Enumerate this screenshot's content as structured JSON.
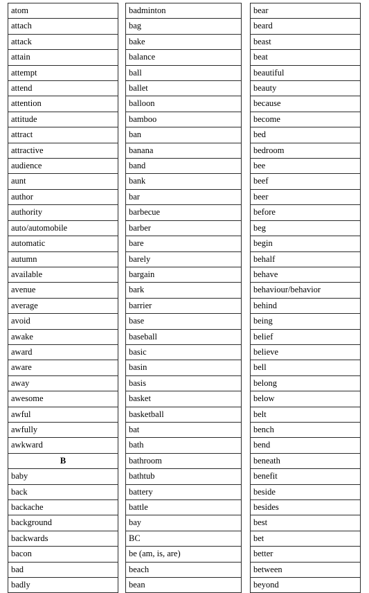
{
  "document": {
    "type": "vocabulary-word-list-table",
    "columns": [
      {
        "name": "column-1",
        "rows": [
          {
            "text": "atom",
            "heading": false
          },
          {
            "text": "attach",
            "heading": false
          },
          {
            "text": "attack",
            "heading": false
          },
          {
            "text": "attain",
            "heading": false
          },
          {
            "text": "attempt",
            "heading": false
          },
          {
            "text": "attend",
            "heading": false
          },
          {
            "text": "attention",
            "heading": false
          },
          {
            "text": "attitude",
            "heading": false
          },
          {
            "text": "attract",
            "heading": false
          },
          {
            "text": "attractive",
            "heading": false
          },
          {
            "text": "audience",
            "heading": false
          },
          {
            "text": "aunt",
            "heading": false
          },
          {
            "text": "author",
            "heading": false
          },
          {
            "text": "authority",
            "heading": false
          },
          {
            "text": "auto/automobile",
            "heading": false
          },
          {
            "text": "automatic",
            "heading": false
          },
          {
            "text": "autumn",
            "heading": false
          },
          {
            "text": "available",
            "heading": false
          },
          {
            "text": "avenue",
            "heading": false
          },
          {
            "text": "average",
            "heading": false
          },
          {
            "text": "avoid",
            "heading": false
          },
          {
            "text": "awake",
            "heading": false
          },
          {
            "text": "award",
            "heading": false
          },
          {
            "text": "aware",
            "heading": false
          },
          {
            "text": "away",
            "heading": false
          },
          {
            "text": "awesome",
            "heading": false
          },
          {
            "text": "awful",
            "heading": false
          },
          {
            "text": "awfully",
            "heading": false
          },
          {
            "text": "awkward",
            "heading": false
          },
          {
            "text": "B",
            "heading": true
          },
          {
            "text": "baby",
            "heading": false
          },
          {
            "text": "back",
            "heading": false
          },
          {
            "text": "backache",
            "heading": false
          },
          {
            "text": "background",
            "heading": false
          },
          {
            "text": "backwards",
            "heading": false
          },
          {
            "text": "bacon",
            "heading": false
          },
          {
            "text": "bad",
            "heading": false
          },
          {
            "text": "badly",
            "heading": false
          }
        ]
      },
      {
        "name": "column-2",
        "rows": [
          {
            "text": "badminton",
            "heading": false
          },
          {
            "text": "bag",
            "heading": false
          },
          {
            "text": "bake",
            "heading": false
          },
          {
            "text": "balance",
            "heading": false
          },
          {
            "text": "ball",
            "heading": false
          },
          {
            "text": "ballet",
            "heading": false
          },
          {
            "text": "balloon",
            "heading": false
          },
          {
            "text": "bamboo",
            "heading": false
          },
          {
            "text": "ban",
            "heading": false
          },
          {
            "text": "banana",
            "heading": false
          },
          {
            "text": "band",
            "heading": false
          },
          {
            "text": "bank",
            "heading": false
          },
          {
            "text": "bar",
            "heading": false
          },
          {
            "text": "barbecue",
            "heading": false
          },
          {
            "text": "barber",
            "heading": false
          },
          {
            "text": "bare",
            "heading": false
          },
          {
            "text": "barely",
            "heading": false
          },
          {
            "text": "bargain",
            "heading": false
          },
          {
            "text": "bark",
            "heading": false
          },
          {
            "text": "barrier",
            "heading": false
          },
          {
            "text": "base",
            "heading": false
          },
          {
            "text": "baseball",
            "heading": false
          },
          {
            "text": "basic",
            "heading": false
          },
          {
            "text": "basin",
            "heading": false
          },
          {
            "text": "basis",
            "heading": false
          },
          {
            "text": "basket",
            "heading": false
          },
          {
            "text": "basketball",
            "heading": false
          },
          {
            "text": "bat",
            "heading": false
          },
          {
            "text": "bath",
            "heading": false
          },
          {
            "text": "bathroom",
            "heading": false
          },
          {
            "text": "bathtub",
            "heading": false
          },
          {
            "text": "battery",
            "heading": false
          },
          {
            "text": "battle",
            "heading": false
          },
          {
            "text": "bay",
            "heading": false
          },
          {
            "text": "BC",
            "heading": false
          },
          {
            "text": "be (am, is, are)",
            "heading": false
          },
          {
            "text": "beach",
            "heading": false
          },
          {
            "text": "bean",
            "heading": false
          }
        ]
      },
      {
        "name": "column-3",
        "rows": [
          {
            "text": "bear",
            "heading": false
          },
          {
            "text": "beard",
            "heading": false
          },
          {
            "text": "beast",
            "heading": false
          },
          {
            "text": "beat",
            "heading": false
          },
          {
            "text": "beautiful",
            "heading": false
          },
          {
            "text": "beauty",
            "heading": false
          },
          {
            "text": "because",
            "heading": false
          },
          {
            "text": "become",
            "heading": false
          },
          {
            "text": "bed",
            "heading": false
          },
          {
            "text": "bedroom",
            "heading": false
          },
          {
            "text": "bee",
            "heading": false
          },
          {
            "text": "beef",
            "heading": false
          },
          {
            "text": "beer",
            "heading": false
          },
          {
            "text": "before",
            "heading": false
          },
          {
            "text": "beg",
            "heading": false
          },
          {
            "text": "begin",
            "heading": false
          },
          {
            "text": "behalf",
            "heading": false
          },
          {
            "text": "behave",
            "heading": false
          },
          {
            "text": "behaviour/behavior",
            "heading": false
          },
          {
            "text": "behind",
            "heading": false
          },
          {
            "text": "being",
            "heading": false
          },
          {
            "text": "belief",
            "heading": false
          },
          {
            "text": "believe",
            "heading": false
          },
          {
            "text": "bell",
            "heading": false
          },
          {
            "text": "belong",
            "heading": false
          },
          {
            "text": "below",
            "heading": false
          },
          {
            "text": "belt",
            "heading": false
          },
          {
            "text": "bench",
            "heading": false
          },
          {
            "text": "bend",
            "heading": false
          },
          {
            "text": "beneath",
            "heading": false
          },
          {
            "text": "benefit",
            "heading": false
          },
          {
            "text": "beside",
            "heading": false
          },
          {
            "text": "besides",
            "heading": false
          },
          {
            "text": "best",
            "heading": false
          },
          {
            "text": "bet",
            "heading": false
          },
          {
            "text": "better",
            "heading": false
          },
          {
            "text": "between",
            "heading": false
          },
          {
            "text": "beyond",
            "heading": false
          }
        ]
      }
    ],
    "colors": {
      "border": "#2b2b2b",
      "text": "#000000",
      "background": "#ffffff"
    }
  }
}
